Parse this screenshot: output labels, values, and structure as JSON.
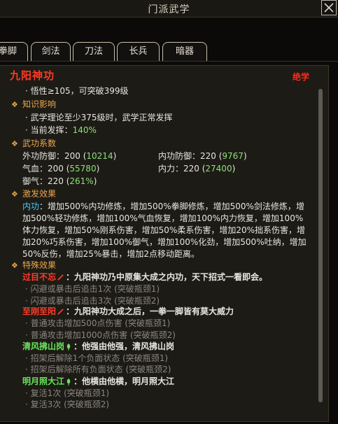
{
  "window": {
    "title": "门派武学",
    "close_icon": "close-icon"
  },
  "tabs": [
    {
      "label": "拳脚"
    },
    {
      "label": "剑法"
    },
    {
      "label": "刀法"
    },
    {
      "label": "长兵"
    },
    {
      "label": "暗器"
    }
  ],
  "skill": {
    "name": "九阳神功",
    "tag": "绝学",
    "requirement": "· 悟性≥105，可突破399级"
  },
  "sections": {
    "influence": {
      "title": "知识影响",
      "line1": "· 武学理论至少375级时，武学正常发挥",
      "line2_prefix": "· 当前发挥：",
      "line2_value": "140%"
    },
    "coeff": {
      "title": "武功系数",
      "ext_def_label": "外功防御：200 (",
      "ext_def_value": "10214",
      "int_def_label": "内功防御：220 (",
      "int_def_value": "9767",
      "qixue_label": "气血：200 (",
      "qixue_value": "55780",
      "neili_label": "内力：220 (",
      "neili_value": "27400",
      "yuqi_label": "御气：220 (",
      "yuqi_value": "261%",
      "close_paren": ")"
    },
    "activate": {
      "title": "激发效果",
      "type_label": "内功",
      "text": "：增加500%内功修炼，增加500%拳脚修炼，增加500%剑法修炼，增加500%轻功修炼，增加100%气血恢复，增加100%内力恢复，增加100%体力恢复，增加50%刚系伤害，增加50%柔系伤害，增加20%拙系伤害，增加20%巧系伤害，增加100%御气，增加100%化劲，增加500%吐纳，增加50%反伤，增加25%暴击，增加2点移动距离。"
    },
    "special": {
      "title": "特殊效果",
      "effects": [
        {
          "name": "过目不忘",
          "desc": "：九阳神功乃中原集大成之内功，天下招式一看即会。",
          "sub1": "· 闪避或暴击后追击1次 (突破瓶颈1)",
          "sub2": "· 闪避或暴击后追击3次 (突破瓶颈2)"
        },
        {
          "name": "至刚至阳",
          "desc": "：九阳神功大成之后，一拳一脚皆有莫大威力",
          "sub1": "· 普通攻击增加500点伤害 (突破瓶颈1)",
          "sub2": "· 普通攻击增加1000点伤害 (突破瓶颈2)"
        },
        {
          "name": "清风拂山岗",
          "desc": "：他强由他强，清风拂山岗",
          "sub1": "· 招架后解除1个负面状态 (突破瓶颈1)",
          "sub2": "· 招架后解除所有负面状态 (突破瓶颈2)"
        },
        {
          "name": "明月照大江",
          "desc": "：他横由他横，明月照大江",
          "sub1": "· 复活1次 (突破瓶颈1)",
          "sub2": "· 复活3次 (突破瓶颈2)"
        }
      ]
    }
  },
  "colors": {
    "accent": "#e9a64d",
    "red": "#ff3a24",
    "green": "#8de07a",
    "cyan": "#42c9ff"
  }
}
